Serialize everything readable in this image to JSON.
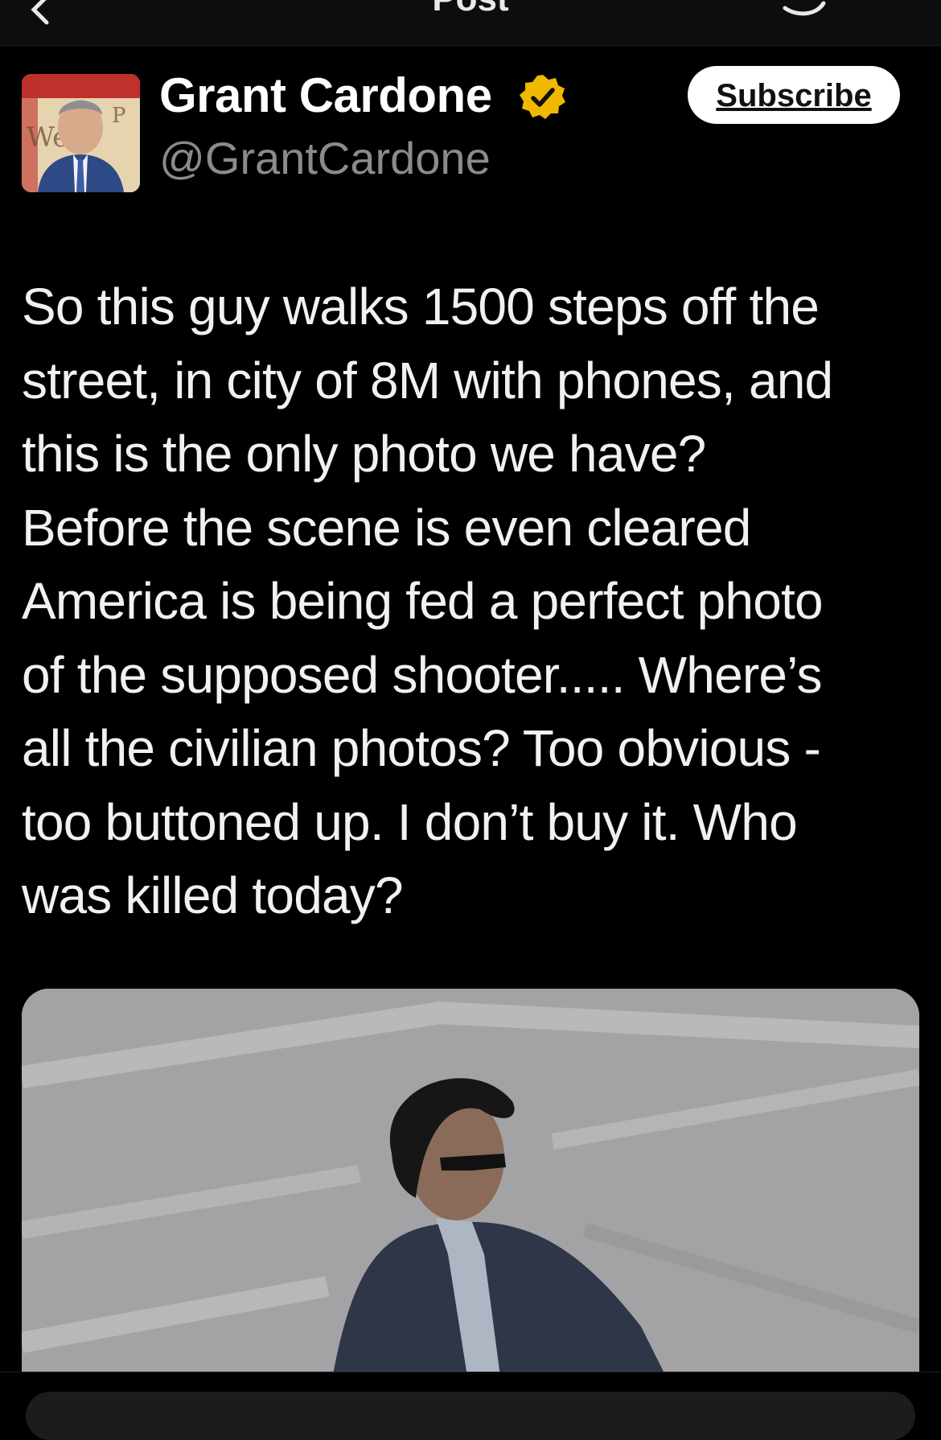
{
  "header": {
    "title": "Post"
  },
  "author": {
    "name": "Grant Cardone",
    "handle": "@GrantCardone",
    "verified_color": "#f0b800"
  },
  "subscribe": {
    "label": "Subscribe"
  },
  "post": {
    "text": "So this guy walks 1500 steps off the\nstreet, in city of 8M with phones, and\nthis is the only photo we have?\nBefore the scene is even cleared\nAmerica is being fed a perfect photo\nof the supposed shooter.....  Where’s\nall the civilian photos?  Too obvious -\ntoo buttoned up.  I don’t buy it.  Who\nwas killed today?"
  },
  "colors": {
    "background": "#000000",
    "text": "#e7e9ea",
    "secondary_text": "#8b8b8b",
    "button_bg": "#ffffff"
  }
}
